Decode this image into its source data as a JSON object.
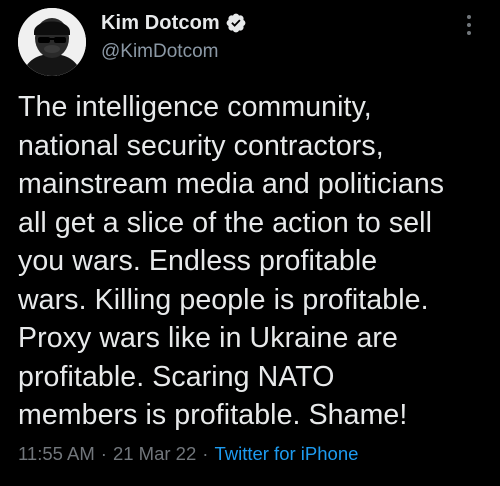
{
  "author": {
    "display_name": "Kim Dotcom",
    "handle": "@KimDotcom",
    "verified": true,
    "avatar": "avatar-image"
  },
  "tweet": {
    "text": "The intelligence community,\nnational security contractors,\nmainstream media and politicians\nall get a slice of the action to sell\nyou wars. Endless profitable\nwars. Killing people is profitable.\nProxy wars like in Ukraine are\nprofitable. Scaring NATO\nmembers is profitable. Shame!",
    "time": "11:55 AM",
    "separator": "·",
    "date": "21 Mar 22",
    "source": "Twitter for iPhone"
  },
  "icons": {
    "verified": "verified-badge-icon",
    "more": "more-options-icon"
  },
  "colors": {
    "background": "#000000",
    "text": "#e7e9ea",
    "secondary": "#71767b",
    "link": "#1d9bf0"
  }
}
